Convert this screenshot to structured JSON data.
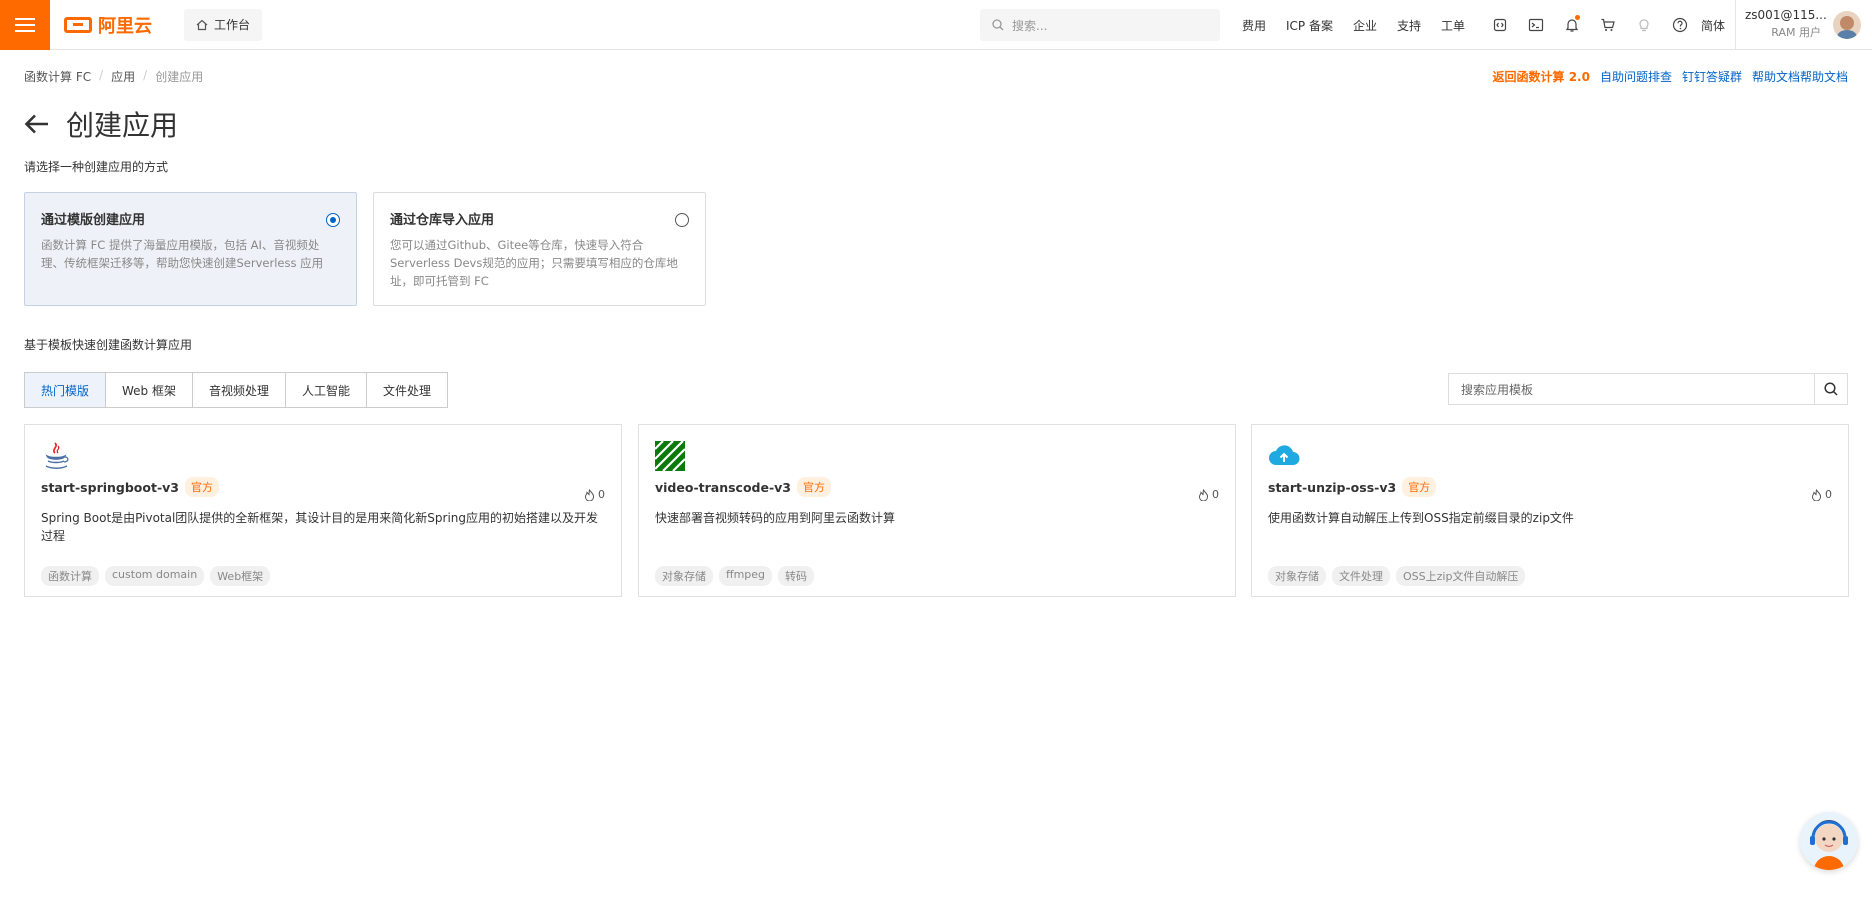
{
  "topbar": {
    "logo_text": "阿里云",
    "workbench": "工作台",
    "search_placeholder": "搜索...",
    "links": [
      "费用",
      "ICP 备案",
      "企业",
      "支持",
      "工单"
    ],
    "lang": "简体",
    "user_name": "zs001@115...",
    "user_role": "RAM 用户",
    "brand_color": "#ff6a00"
  },
  "breadcrumb": [
    "函数计算 FC",
    "应用",
    "创建应用"
  ],
  "help_links": [
    "返回函数计算 2.0",
    "自助问题排查",
    "钉钉答疑群",
    "帮助文档帮助文档"
  ],
  "page": {
    "title": "创建应用",
    "subtitle": "请选择一种创建应用的方式",
    "section_label": "基于模板快速创建函数计算应用"
  },
  "options": [
    {
      "title": "通过模版创建应用",
      "desc": "函数计算 FC 提供了海量应用模版，包括 AI、音视频处理、传统框架迁移等，帮助您快速创建Serverless 应用",
      "selected": true
    },
    {
      "title": "通过仓库导入应用",
      "desc": "您可以通过Github、Gitee等仓库，快速导入符合 Serverless Devs规范的应用；只需要填写相应的仓库地址，即可托管到 FC",
      "selected": false
    }
  ],
  "tabs": [
    "热门模版",
    "Web 框架",
    "音视频处理",
    "人工智能",
    "文件处理"
  ],
  "template_search_placeholder": "搜索应用模板",
  "templates": [
    {
      "name": "start-springboot-v3",
      "badge": "官方",
      "likes": "0",
      "desc": "Spring Boot是由Pivotal团队提供的全新框架，其设计目的是用来简化新Spring应用的初始搭建以及开发过程",
      "tags": [
        "函数计算",
        "custom domain",
        "Web框架"
      ],
      "icon": "java-icon"
    },
    {
      "name": "video-transcode-v3",
      "badge": "官方",
      "likes": "0",
      "desc": "快速部署音视频转码的应用到阿里云函数计算",
      "tags": [
        "对象存储",
        "ffmpeg",
        "转码"
      ],
      "icon": "ffmpeg-icon"
    },
    {
      "name": "start-unzip-oss-v3",
      "badge": "官方",
      "likes": "0",
      "desc": "使用函数计算自动解压上传到OSS指定前缀目录的zip文件",
      "tags": [
        "对象存储",
        "文件处理",
        "OSS上zip文件自动解压"
      ],
      "icon": "cloud-upload-icon"
    }
  ]
}
